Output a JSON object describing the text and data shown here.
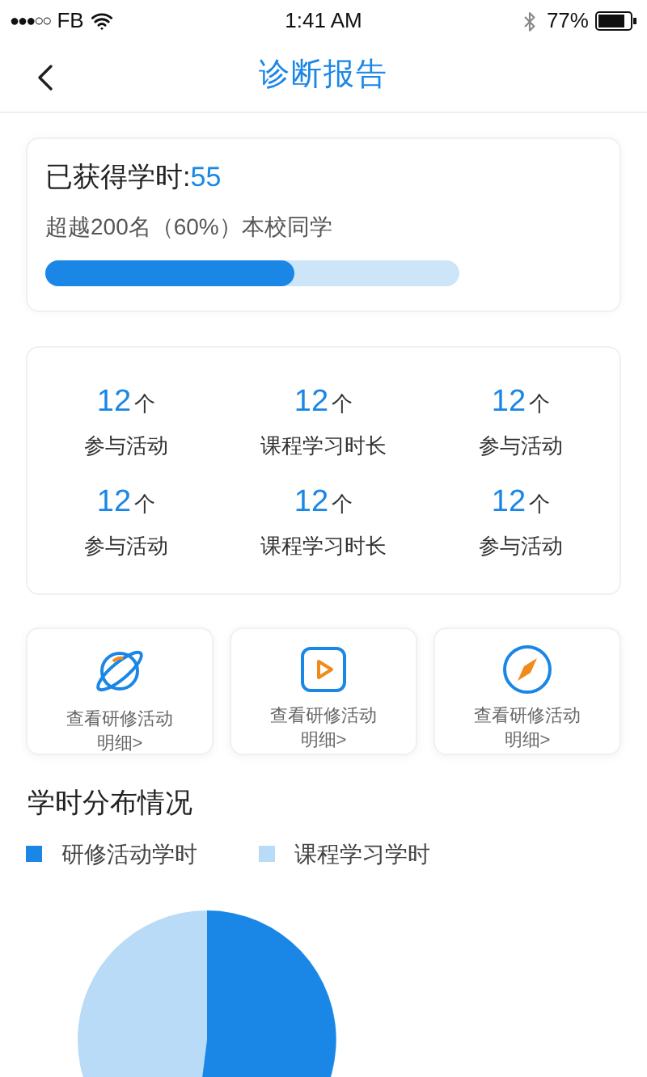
{
  "status_bar": {
    "signal": "●●●○○",
    "carrier": "FB",
    "time": "1:41 AM",
    "battery": "77%"
  },
  "nav": {
    "title": "诊断报告"
  },
  "hours_card": {
    "label": "已获得学时:",
    "value": "55",
    "subtitle": "超越200名（60%）本校同学",
    "level": 0.6
  },
  "stats": [
    {
      "value": "12",
      "unit": "个",
      "label": "参与活动"
    },
    {
      "value": "12",
      "unit": "个",
      "label": "课程学习时长"
    },
    {
      "value": "12",
      "unit": "个",
      "label": "参与活动"
    },
    {
      "value": "12",
      "unit": "个",
      "label": "参与活动"
    },
    {
      "value": "12",
      "unit": "个",
      "label": "课程学习时长"
    },
    {
      "value": "12",
      "unit": "个",
      "label": "参与活动"
    }
  ],
  "shortcuts": [
    {
      "kind": "planet",
      "line1": "查看研修活动",
      "line2": "明细>"
    },
    {
      "kind": "play",
      "line1": "查看研修活动",
      "line2": "明细>"
    },
    {
      "kind": "compass",
      "line1": "查看研修活动",
      "line2": "明细>"
    }
  ],
  "distribution": {
    "title": "学时分布情况",
    "legend": [
      {
        "label": "研修活动学时",
        "color": "#1a87e6"
      },
      {
        "label": "课程学习学时",
        "color": "#b9dbf7"
      }
    ]
  }
}
